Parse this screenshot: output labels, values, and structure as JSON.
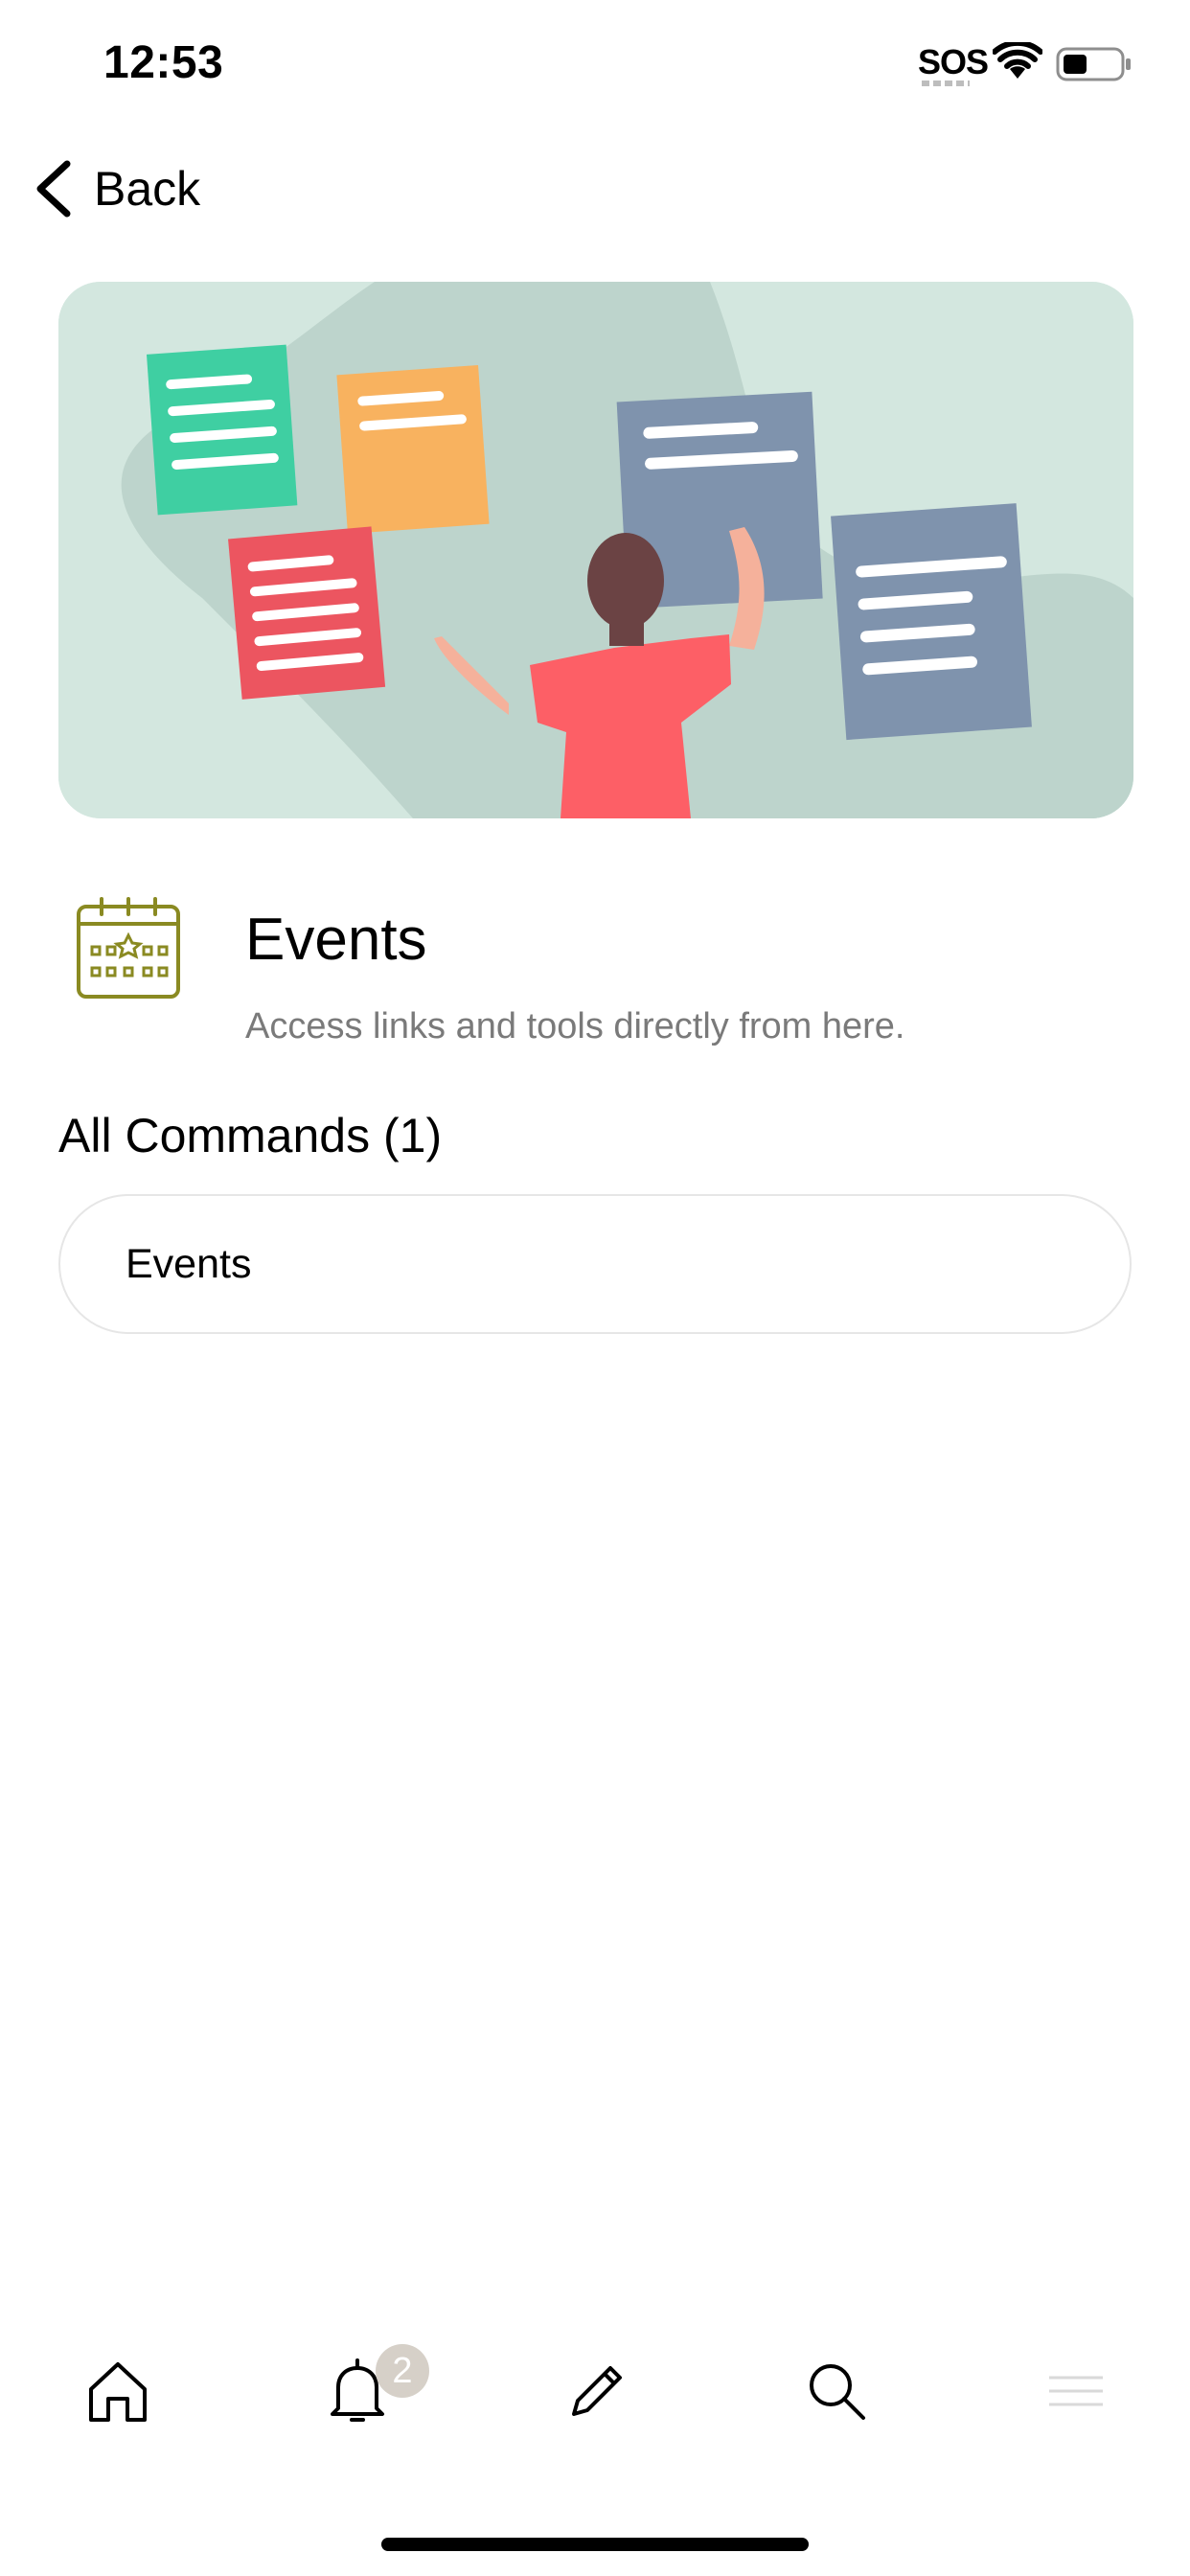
{
  "status_bar": {
    "time": "12:53",
    "sos": "SOS"
  },
  "nav": {
    "back_label": "Back"
  },
  "section": {
    "title": "Events",
    "subtitle": "Access links and tools directly from here.",
    "icon": "calendar-star-icon",
    "icon_color": "#8a8a22"
  },
  "commands": {
    "header": "All Commands (1)",
    "items": [
      {
        "label": "Events"
      }
    ]
  },
  "tab_bar": {
    "items": [
      {
        "icon": "home-icon"
      },
      {
        "icon": "bell-icon",
        "badge": "2"
      },
      {
        "icon": "pencil-icon"
      },
      {
        "icon": "search-icon"
      },
      {
        "icon": "menu-icon"
      }
    ]
  },
  "colors": {
    "hero_bg": "#d3e7df",
    "note_green": "#3fcfa2",
    "note_orange": "#f8b25f",
    "note_red": "#ec5560",
    "note_slate": "#7f93ad",
    "badge_bg": "#d6d0c8"
  }
}
